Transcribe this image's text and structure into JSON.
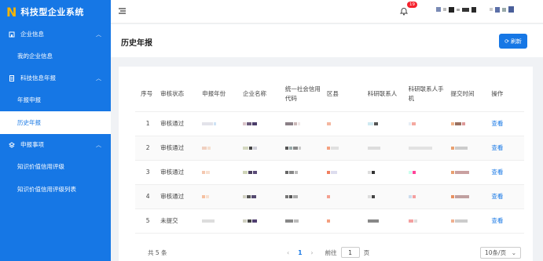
{
  "app": {
    "logo_text": "N",
    "title": "科技型企业系统"
  },
  "sidebar": {
    "groups": [
      {
        "label": "企业信息",
        "items": [
          {
            "label": "我的企业信息"
          }
        ]
      },
      {
        "label": "科技信息年报",
        "items": [
          {
            "label": "年报申报"
          },
          {
            "label": "历史年报"
          }
        ]
      },
      {
        "label": "申报事项",
        "items": [
          {
            "label": "知识价值信用评级"
          },
          {
            "label": "知识价值信用评级列表"
          }
        ]
      }
    ]
  },
  "header": {
    "notification_count": "19"
  },
  "page": {
    "title": "历史年报",
    "refresh_label": "刷新"
  },
  "table": {
    "columns": [
      "序号",
      "审核状态",
      "申报年份",
      "企业名称",
      "统一社会信用代码",
      "区县",
      "科研联系人",
      "科研联系人手机",
      "提交时间",
      "操作"
    ],
    "rows": [
      {
        "no": "1",
        "status": "审核通过",
        "action": "查看"
      },
      {
        "no": "2",
        "status": "审核通过",
        "action": "查看"
      },
      {
        "no": "3",
        "status": "审核通过",
        "action": "查看"
      },
      {
        "no": "4",
        "status": "审核通过",
        "action": "查看"
      },
      {
        "no": "5",
        "status": "未提交",
        "action": "查看"
      }
    ]
  },
  "pagination": {
    "total_label": "共 5 条",
    "current_page": "1",
    "goto_prefix": "前往",
    "goto_value": "1",
    "goto_suffix": "页",
    "page_size": "10条/页"
  },
  "colors": {
    "primary": "#1677e5",
    "logo": "#f5b400",
    "badge": "#f5222d"
  }
}
